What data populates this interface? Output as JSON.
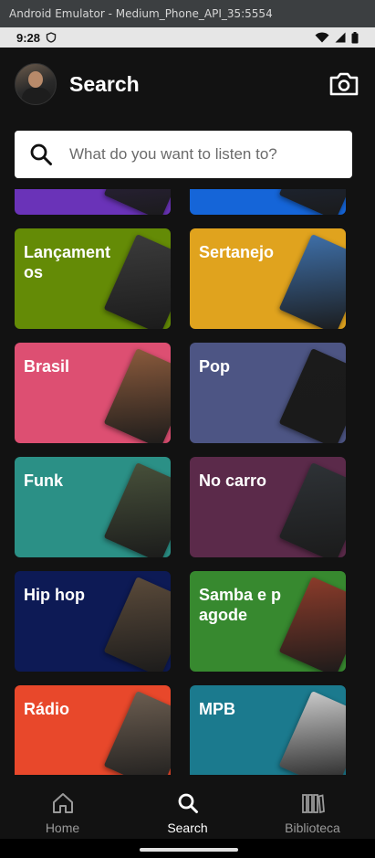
{
  "window": {
    "title": "Android Emulator - Medium_Phone_API_35:5554"
  },
  "status_bar": {
    "time": "9:28"
  },
  "header": {
    "title": "Search",
    "avatar_icon": "profile-photo",
    "camera_icon": "camera-icon"
  },
  "search": {
    "placeholder": "What do you want to listen to?"
  },
  "categories": [
    {
      "label": "",
      "color": "#6a33b8",
      "art": "#3a2a5a"
    },
    {
      "label": "",
      "color": "#1565d8",
      "art": "#22314f"
    },
    {
      "label": "Lançamentos",
      "color": "#648b06",
      "art": "#3b3b3b"
    },
    {
      "label": "Sertanejo",
      "color": "#e0a31e",
      "art": "#3e6fa8"
    },
    {
      "label": "Brasil",
      "color": "#dd4f72",
      "art": "#8a5a3c"
    },
    {
      "label": "Pop",
      "color": "#4d5584",
      "art": "#1b1b1b"
    },
    {
      "label": "Funk",
      "color": "#2b9086",
      "art": "#47503a"
    },
    {
      "label": "No carro",
      "color": "#5b2a4a",
      "art": "#2e3236"
    },
    {
      "label": "Hip hop",
      "color": "#0d1a55",
      "art": "#5a4a3a"
    },
    {
      "label": "Samba e pagode",
      "color": "#37892f",
      "art": "#8b3b2a"
    },
    {
      "label": "Rádio",
      "color": "#e8482b",
      "art": "#6b5d50"
    },
    {
      "label": "MPB",
      "color": "#1b7a8e",
      "art": "#c9c9c9"
    }
  ],
  "bottom_nav": {
    "home": "Home",
    "search": "Search",
    "library": "Biblioteca"
  }
}
